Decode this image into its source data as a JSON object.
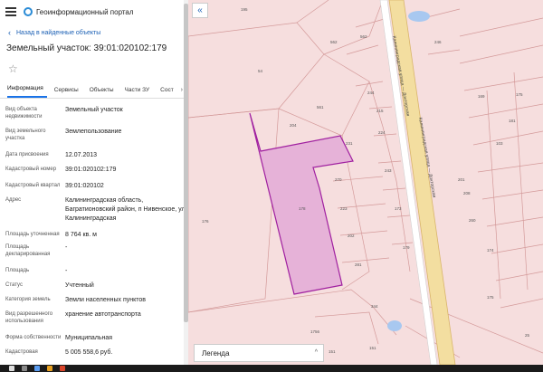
{
  "app": {
    "title": "Геоинформационный портал"
  },
  "nav": {
    "back_label": "Назад в найденные объекты"
  },
  "parcel": {
    "title": "Земельный участок: 39:01:020102:179"
  },
  "tabs": [
    {
      "label": "Информация",
      "active": true
    },
    {
      "label": "Сервисы"
    },
    {
      "label": "Объекты"
    },
    {
      "label": "Части ЗУ"
    },
    {
      "label": "Сост"
    }
  ],
  "attributes": [
    {
      "label": "Вид объекта недвижимости",
      "value": "Земельный участок"
    },
    {
      "label": "Вид земельного участка",
      "value": "Землепользование"
    },
    {
      "label": "Дата присвоения",
      "value": "12.07.2013"
    },
    {
      "label": "Кадастровый номер",
      "value": "39:01:020102:179"
    },
    {
      "label": "Кадастровый квартал",
      "value": "39:01:020102"
    },
    {
      "label": "Адрес",
      "value": "Калининградская область, Багратионовский район, п Нивенское, ул Калининградская"
    },
    {
      "label": "Площадь уточненная",
      "value": "8 764 кв. м"
    },
    {
      "label": "Площадь декларированная",
      "value": "-"
    },
    {
      "label": "Площадь",
      "value": "-"
    },
    {
      "label": "Статус",
      "value": "Учтенный"
    },
    {
      "label": "Категория земель",
      "value": "Земли населенных пунктов"
    },
    {
      "label": "Вид разрешенного использования",
      "value": "хранение автотранспорта"
    },
    {
      "label": "Форма собственности",
      "value": "Муниципальная"
    },
    {
      "label": "Кадастровая",
      "value": "5 005 558,6 руб."
    }
  ],
  "map": {
    "street_label_1": "Калининградская улица — Докторская",
    "street_label_2": "Калининградская улица — Докторская",
    "parcel_labels": [
      "195",
      "562",
      "246",
      "54",
      "561",
      "562",
      "244",
      "204",
      "215",
      "224",
      "231",
      "243",
      "201",
      "176",
      "169",
      "173",
      "270",
      "223",
      "202",
      "281",
      "179",
      "181",
      "103",
      "175",
      "208",
      "260",
      "174",
      "344",
      "1756",
      "151",
      "151",
      "175",
      "25"
    ],
    "highlight_label": "178",
    "colors": {
      "background": "#f6dede",
      "highlight": "#e6b2d8",
      "highlight_border": "#a020a0",
      "road": "#f3dea0"
    }
  },
  "legend": {
    "label": "Легенда"
  }
}
